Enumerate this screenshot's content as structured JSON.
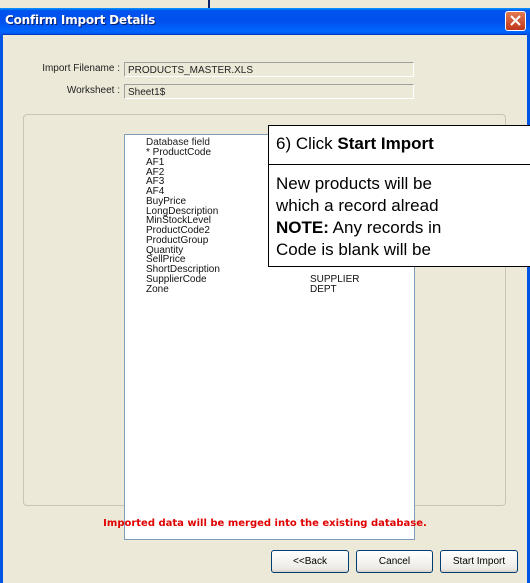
{
  "window": {
    "title": "Confirm Import Details"
  },
  "fields": {
    "filename_label": "Import Filename :",
    "filename_value": "PRODUCTS_MASTER.XLS",
    "worksheet_label": "Worksheet :",
    "worksheet_value": "Sheet1$"
  },
  "list": {
    "header_col1": "Database field",
    "rows": [
      {
        "field": "* ProductCode",
        "mapped": ""
      },
      {
        "field": "AF1",
        "mapped": ""
      },
      {
        "field": "AF2",
        "mapped": ""
      },
      {
        "field": "AF3",
        "mapped": ""
      },
      {
        "field": "AF4",
        "mapped": ""
      },
      {
        "field": "BuyPrice",
        "mapped": ""
      },
      {
        "field": "LongDescription",
        "mapped": ""
      },
      {
        "field": "MinStockLevel",
        "mapped": ""
      },
      {
        "field": "ProductCode2",
        "mapped": ""
      },
      {
        "field": "ProductGroup",
        "mapped": ""
      },
      {
        "field": "Quantity",
        "mapped": ""
      },
      {
        "field": "SellPrice",
        "mapped": ""
      },
      {
        "field": "ShortDescription",
        "mapped": ""
      },
      {
        "field": "SupplierCode",
        "mapped": "SUPPLIER"
      },
      {
        "field": "Zone",
        "mapped": "DEPT"
      }
    ]
  },
  "callout": {
    "heading_prefix": "6) Click ",
    "heading_bold": "Start Import",
    "line1": "New products will be",
    "line2": "which a record alread",
    "line3_bold": "NOTE:",
    "line3_rest": " Any records in",
    "line4": "Code is blank will be"
  },
  "message": "Imported data will be merged into the existing database.",
  "buttons": {
    "back": "<<Back",
    "cancel": "Cancel",
    "start": "Start Import"
  }
}
